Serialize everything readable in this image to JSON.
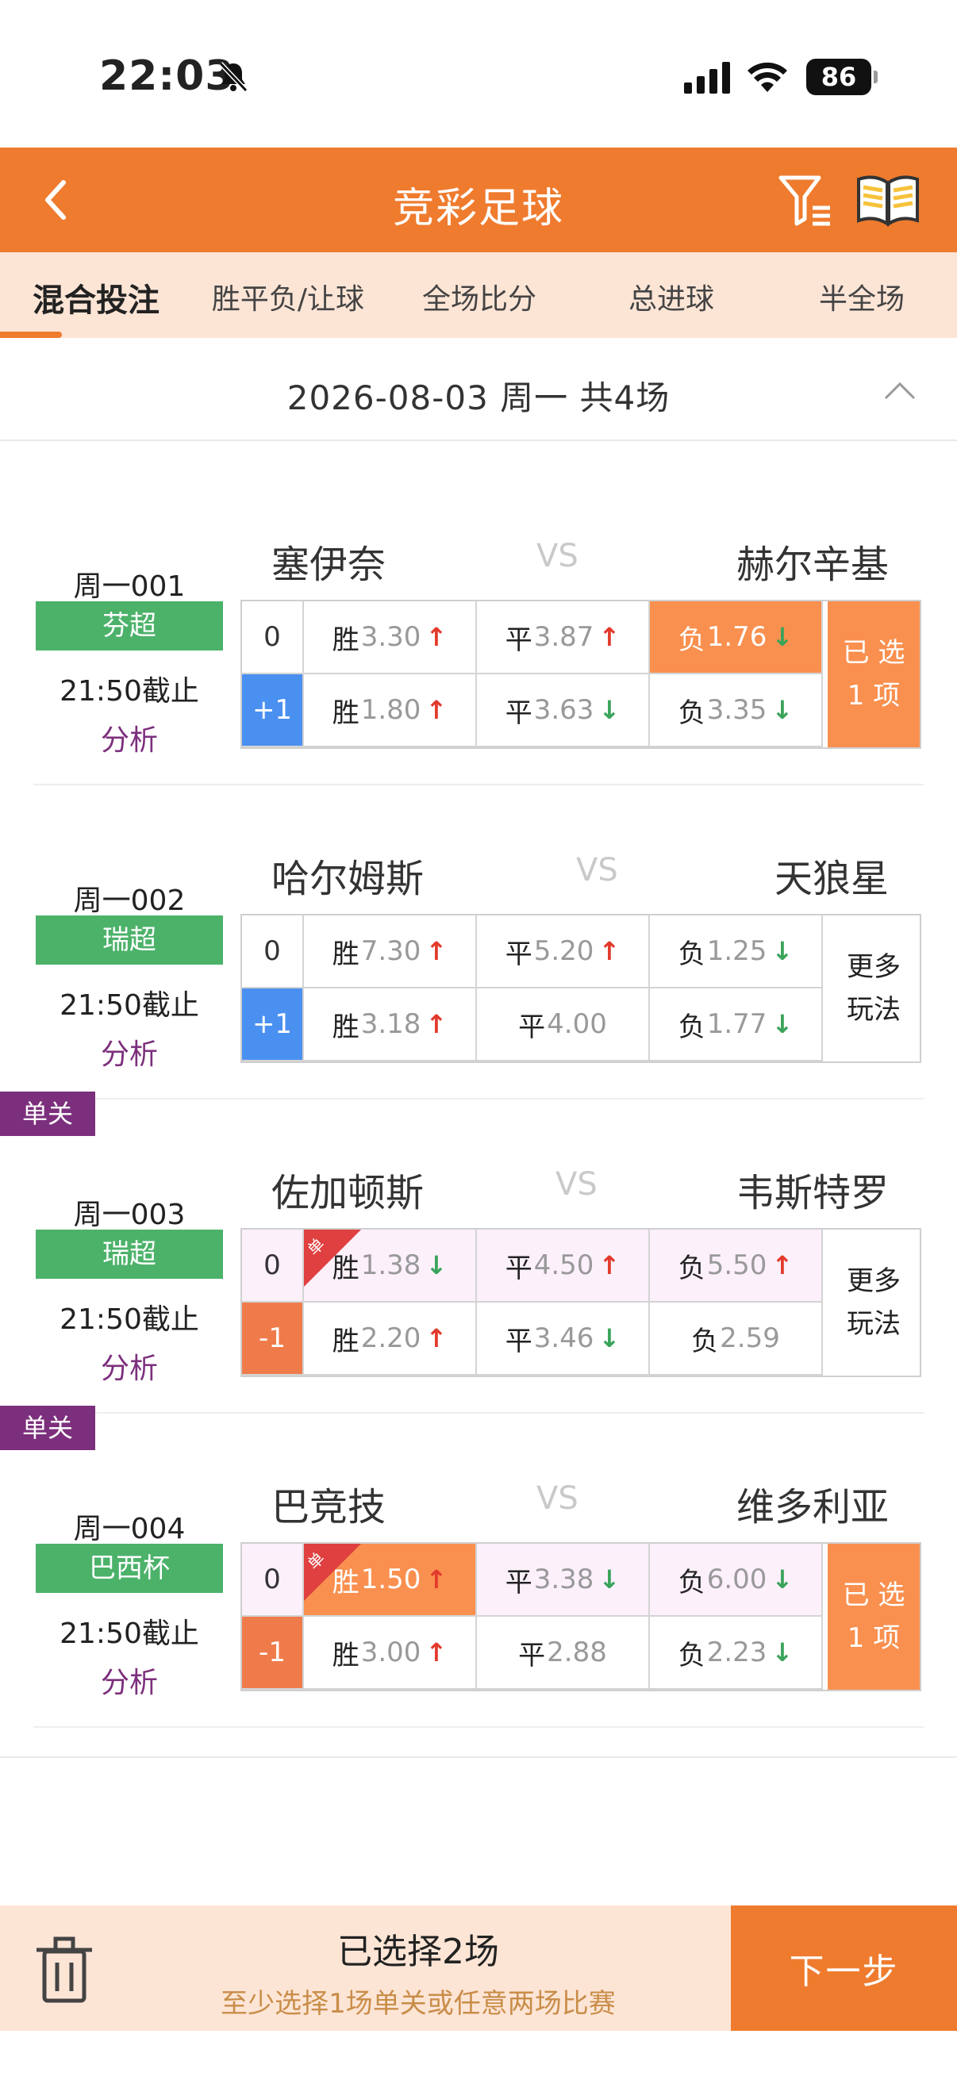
{
  "status": {
    "time": "22:03",
    "battery": "86"
  },
  "nav": {
    "title": "竞彩足球"
  },
  "tabs": [
    "混合投注",
    "胜平负/让球",
    "全场比分",
    "总进球",
    "半全场"
  ],
  "date_header": "2026-08-03  周一  共4场",
  "matches": [
    {
      "code": "周一001",
      "league": "芬超",
      "deadline": "21:50截止",
      "analysis": "分析",
      "single": "",
      "home": "塞伊奈",
      "vs": "VS",
      "away": "赫尔辛基",
      "row0": {
        "hc": "0",
        "w": "胜",
        "wo": "3.30",
        "d": "平",
        "do": "3.87",
        "l": "负",
        "lo": "1.76"
      },
      "row1": {
        "hc": "+1",
        "w": "胜",
        "wo": "1.80",
        "d": "平",
        "do": "3.63",
        "l": "负",
        "lo": "3.35"
      },
      "side": "已 选\n1 项"
    },
    {
      "code": "周一002",
      "league": "瑞超",
      "deadline": "21:50截止",
      "analysis": "分析",
      "single": "",
      "home": "哈尔姆斯",
      "vs": "VS",
      "away": "天狼星",
      "row0": {
        "hc": "0",
        "w": "胜",
        "wo": "7.30",
        "d": "平",
        "do": "5.20",
        "l": "负",
        "lo": "1.25"
      },
      "row1": {
        "hc": "+1",
        "w": "胜",
        "wo": "3.18",
        "d": "平",
        "do": "4.00",
        "l": "负",
        "lo": "1.77"
      },
      "side": "更多\n玩法"
    },
    {
      "code": "周一003",
      "league": "瑞超",
      "deadline": "21:50截止",
      "analysis": "分析",
      "single": "单关",
      "home": "佐加顿斯",
      "vs": "VS",
      "away": "韦斯特罗",
      "row0": {
        "hc": "0",
        "w": "胜",
        "wo": "1.38",
        "d": "平",
        "do": "4.50",
        "l": "负",
        "lo": "5.50"
      },
      "row1": {
        "hc": "-1",
        "w": "胜",
        "wo": "2.20",
        "d": "平",
        "do": "3.46",
        "l": "负",
        "lo": "2.59"
      },
      "side": "更多\n玩法"
    },
    {
      "code": "周一004",
      "league": "巴西杯",
      "deadline": "21:50截止",
      "analysis": "分析",
      "single": "单关",
      "home": "巴竞技",
      "vs": "VS",
      "away": "维多利亚",
      "row0": {
        "hc": "0",
        "w": "胜",
        "wo": "1.50",
        "d": "平",
        "do": "3.38",
        "l": "负",
        "lo": "6.00"
      },
      "row1": {
        "hc": "-1",
        "w": "胜",
        "wo": "3.00",
        "d": "平",
        "do": "2.88",
        "l": "负",
        "lo": "2.23"
      },
      "side": "已 选\n1 项"
    }
  ],
  "ribbon_text": "单",
  "bottom": {
    "selected": "已选择2场",
    "hint": "至少选择1场单关或任意两场比赛",
    "next": "下一步"
  }
}
